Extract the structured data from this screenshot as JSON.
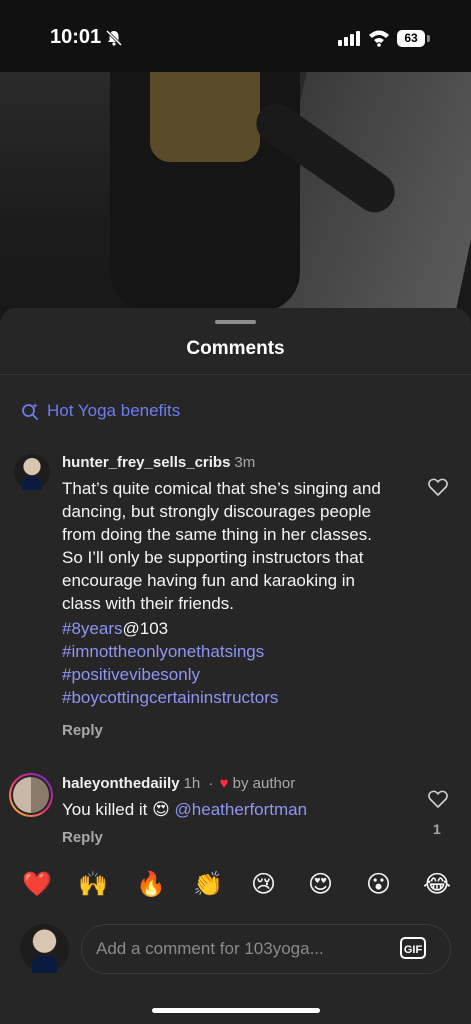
{
  "status": {
    "time": "10:01",
    "battery": "63"
  },
  "sheet": {
    "title": "Comments"
  },
  "search_suggestion": {
    "label": "Hot Yoga benefits"
  },
  "comments": [
    {
      "username": "hunter_frey_sells_cribs",
      "time": "3m",
      "text": "That’s quite comical that she’s singing and dancing, but strongly discourages people from doing the same thing in her classes. So I’ll only be supporting instructors that encourage having fun and karaoking in class with their friends.",
      "tag1": "#8years",
      "tag1_suffix": "@103",
      "tags": [
        "#imnottheonlyonethatsings",
        "#positivevibesonly",
        "#boycottingcertaininstructors"
      ],
      "reply_label": "Reply"
    },
    {
      "username": "haleyonthedaiily",
      "time": "1h",
      "separator": "·",
      "by_author": "by author",
      "text_prefix": "You killed it 😍 ",
      "mention": "@heatherfortman",
      "likes": "1",
      "reply_label": "Reply"
    }
  ],
  "reactions": [
    "❤️",
    "🙌",
    "🔥",
    "👏",
    "😢",
    "😍",
    "😮",
    "😂"
  ],
  "composer": {
    "placeholder": "Add a comment for 103yoga...",
    "gif_label": "GIF"
  },
  "colors": {
    "accent": "#6e7cf2",
    "heart_red": "#ff3040",
    "sheet_bg": "#262626"
  }
}
